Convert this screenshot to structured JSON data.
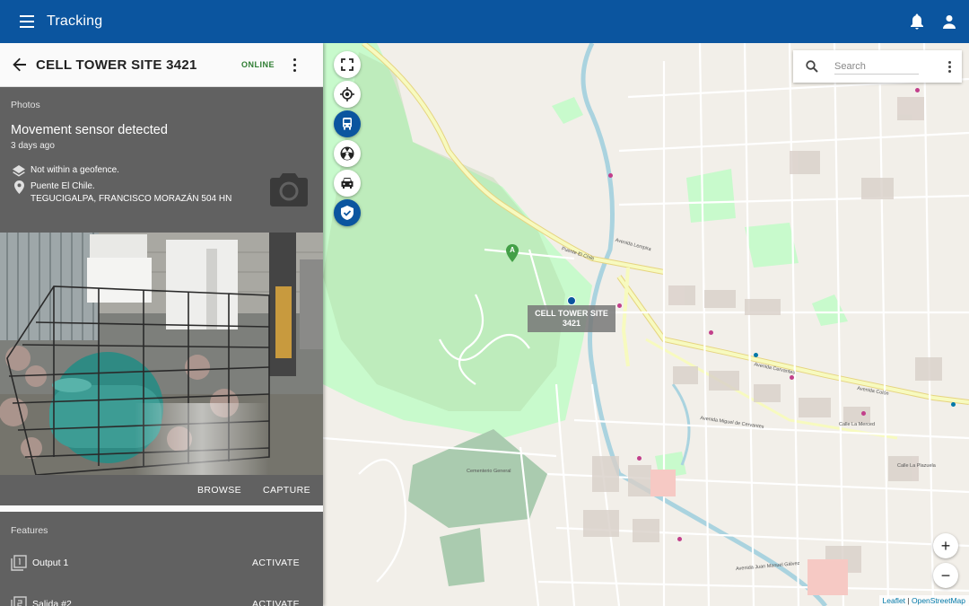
{
  "appbar": {
    "title": "Tracking"
  },
  "panel": {
    "device_name": "CELL TOWER SITE 3421",
    "status": "ONLINE",
    "photos_label": "Photos",
    "event_title": "Movement sensor detected",
    "event_time": "3 days ago",
    "geofence_text": "Not within a geofence.",
    "location_line1": "Puente El Chile.",
    "location_line2": "TEGUCIGALPA, FRANCISCO MORAZÁN 504 HN",
    "browse_label": "BROWSE",
    "capture_label": "CAPTURE",
    "features_label": "Features",
    "features": [
      {
        "name": "Output 1",
        "action": "ACTIVATE"
      },
      {
        "name": "Salida #2",
        "action": "ACTIVATE"
      }
    ]
  },
  "map": {
    "search_placeholder": "Search",
    "marker_label_line1": "CELL TOWER SITE",
    "marker_label_line2": "3421",
    "pin_letter": "A",
    "zoom_in": "+",
    "zoom_out": "−",
    "attribution_leaflet": "Leaflet",
    "attribution_sep": " | ",
    "attribution_osm": "OpenStreetMap",
    "street_labels": [
      "Puente El Chile",
      "Avenida Lempira",
      "Avenida Cervantes",
      "Avenida Miguel de Cervantes",
      "Calle La Merced",
      "Avenida Colón",
      "Cementerio General",
      "Calle La Plazuela",
      "Avenida Juan Manuel Gálvez"
    ]
  },
  "colors": {
    "appbar": "#0b559f",
    "panel": "#616161",
    "online": "#2e7d32",
    "park": "#c8facc",
    "water": "#aad3df",
    "road_major": "#f7fabf"
  }
}
